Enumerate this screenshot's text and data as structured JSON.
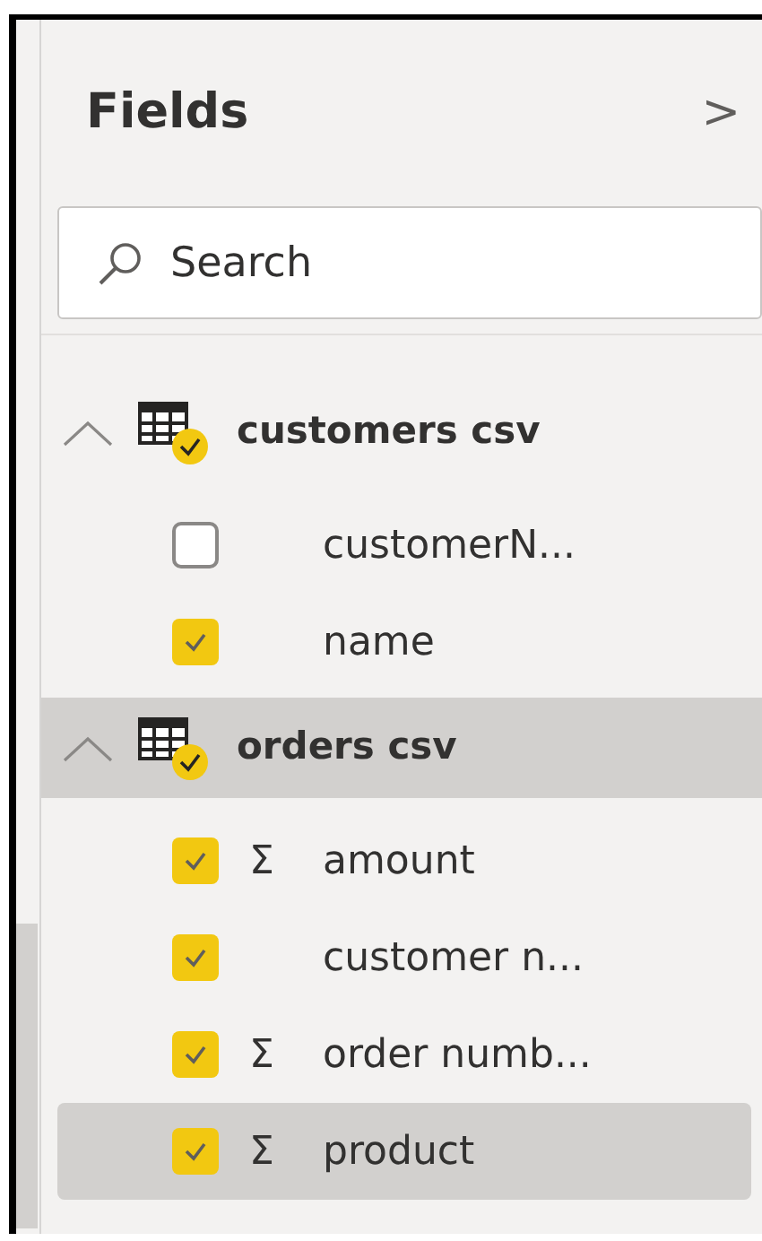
{
  "pane": {
    "title": "Fields",
    "collapse_glyph": ">"
  },
  "search": {
    "placeholder": "Search"
  },
  "tables": [
    {
      "name": "customers csv",
      "expanded": true,
      "highlighted": false,
      "fields": [
        {
          "name": "customerN...",
          "checked": false,
          "highlighted": false
        },
        {
          "name": "name",
          "checked": true,
          "highlighted": false
        }
      ]
    },
    {
      "name": "orders csv",
      "expanded": true,
      "highlighted": true,
      "fields": [
        {
          "name": "amount",
          "checked": true,
          "highlighted": false,
          "aggregate": "Σ"
        },
        {
          "name": "customer n...",
          "checked": true,
          "highlighted": false
        },
        {
          "name": "order numb...",
          "checked": true,
          "highlighted": false,
          "aggregate": "Σ"
        },
        {
          "name": "product",
          "checked": true,
          "highlighted": true,
          "aggregate": "Σ"
        }
      ]
    }
  ]
}
